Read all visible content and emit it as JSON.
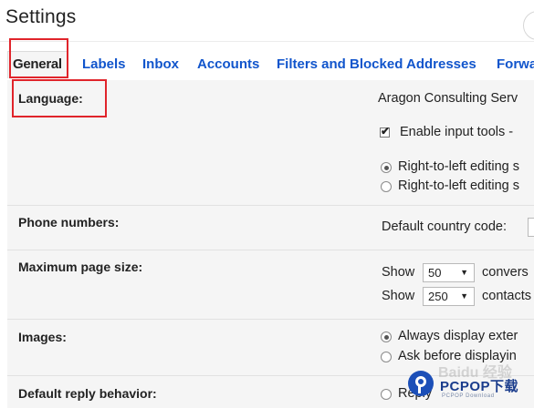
{
  "header": {
    "title": "Settings"
  },
  "tabs": [
    {
      "label": "General"
    },
    {
      "label": "Labels"
    },
    {
      "label": "Inbox"
    },
    {
      "label": "Accounts"
    },
    {
      "label": "Filters and Blocked Addresses"
    },
    {
      "label": "Forwa"
    }
  ],
  "sections": {
    "language": {
      "label": "Language:",
      "value": "Aragon Consulting Serv",
      "enable_input_tools": {
        "label": "Enable input tools -",
        "checked": true
      },
      "rtl_options": [
        {
          "label": "Right-to-left editing s",
          "selected": true
        },
        {
          "label": "Right-to-left editing s",
          "selected": false
        }
      ]
    },
    "phone": {
      "label": "Phone numbers:",
      "country_code_label": "Default country code:"
    },
    "page_size": {
      "label": "Maximum page size:",
      "rows": [
        {
          "prefix": "Show",
          "value": "50",
          "suffix": "convers"
        },
        {
          "prefix": "Show",
          "value": "250",
          "suffix": "contacts"
        }
      ]
    },
    "images": {
      "label": "Images:",
      "options": [
        {
          "label": "Always display exter",
          "selected": true
        },
        {
          "label": "Ask before displayin",
          "selected": false
        }
      ]
    },
    "reply": {
      "label": "Default reply behavior:",
      "options": [
        {
          "label": "Reply",
          "selected": false
        }
      ]
    }
  },
  "watermark": {
    "brand": "PCPOP下载",
    "sub": "PCPOP Download",
    "faint": "Baidu 经验"
  },
  "colors": {
    "link": "#1155cc",
    "highlight": "#e0242b",
    "panel_bg": "#f5f5f5"
  }
}
